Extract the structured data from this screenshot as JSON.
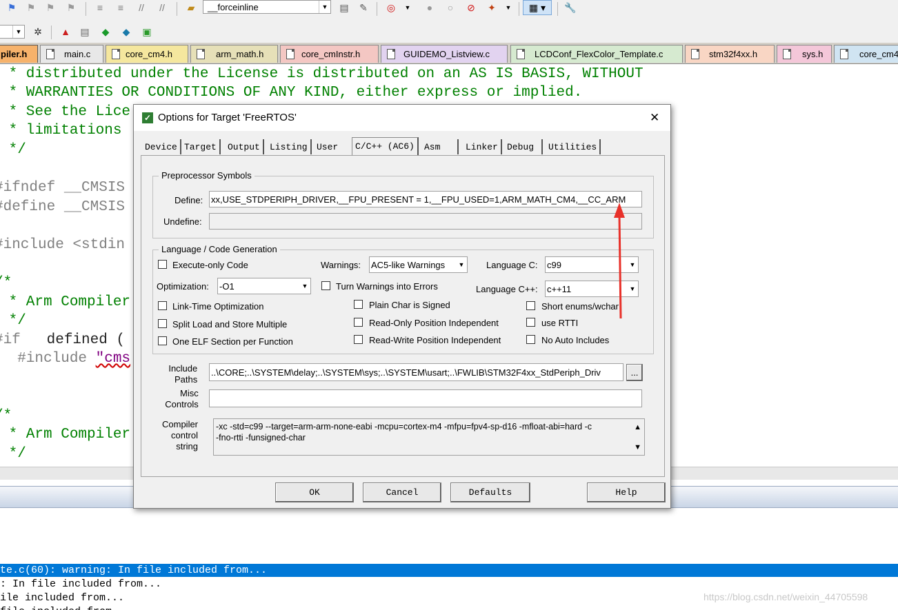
{
  "toolbar": {
    "target_combo": "__forceinline"
  },
  "file_tabs": [
    {
      "label": "piler.h",
      "color": "#f6b26b"
    },
    {
      "label": "main.c",
      "color": "#e8e8e8"
    },
    {
      "label": "core_cm4.h",
      "color": "#f5e79e"
    },
    {
      "label": "arm_math.h",
      "color": "#e6e0b8"
    },
    {
      "label": "core_cmInstr.h",
      "color": "#f4c7c3"
    },
    {
      "label": "GUIDEMO_Listview.c",
      "color": "#e2d3f0"
    },
    {
      "label": "LCDConf_FlexColor_Template.c",
      "color": "#d6ead0"
    },
    {
      "label": "stm32f4xx.h",
      "color": "#f9d6c4"
    },
    {
      "label": "sys.h",
      "color": "#f4c7d9"
    },
    {
      "label": "core_cm4",
      "color": "#d0e4f2"
    }
  ],
  "code_lines": {
    "l1": " * distributed under the License is distributed on an AS IS BASIS, WITHOUT",
    "l2": " * WARRANTIES OR CONDITIONS OF ANY KIND, either express or implied.",
    "l3": " * See the Lice",
    "l4": " * limitations",
    "l5": " */",
    "l6": "#ifndef __CMSIS",
    "l7": "#define __CMSIS",
    "l8": "#include <stdin",
    "l9": "/*",
    "l10": " * Arm Compiler",
    "l11": " */",
    "l12a": "#if",
    "l12b": "   defined (",
    "l13a": "  #include ",
    "l13b": "\"cms",
    "l14": "/*",
    "l15": " * Arm Compiler",
    "l16": " */"
  },
  "output": {
    "selected": "te.c(60): warning: In file included from...",
    "line2": ": In file included from...",
    "line3": "ile included from...",
    "line4": "file included from..."
  },
  "watermark": "https://blog.csdn.net/weixin_44705598",
  "dialog": {
    "title": "Options for Target 'FreeRTOS'",
    "close": "✕",
    "tabs": [
      "Device",
      "Target",
      "Output",
      "Listing",
      "User",
      "C/C++ (AC6)",
      "Asm",
      "Linker",
      "Debug",
      "Utilities"
    ],
    "active_tab": "C/C++ (AC6)",
    "preprocessor": {
      "group": "Preprocessor Symbols",
      "define_label": "Define:",
      "define_value": "xx,USE_STDPERIPH_DRIVER,__FPU_PRESENT = 1,__FPU_USED=1,ARM_MATH_CM4,__CC_ARM",
      "undefine_label": "Undefine:",
      "undefine_value": ""
    },
    "language": {
      "group": "Language / Code Generation",
      "execute_only": "Execute-only Code",
      "warnings_label": "Warnings:",
      "warnings_value": "AC5-like Warnings",
      "language_c_label": "Language C:",
      "language_c_value": "c99",
      "optimization_label": "Optimization:",
      "optimization_value": "-O1",
      "turn_warnings": "Turn Warnings into Errors",
      "language_cpp_label": "Language C++:",
      "language_cpp_value": "c++11",
      "link_time": "Link-Time Optimization",
      "plain_char": "Plain Char is Signed",
      "short_enums": "Short enums/wchar",
      "split_load": "Split Load and Store Multiple",
      "read_only": "Read-Only Position Independent",
      "use_rtti": "use RTTI",
      "one_elf": "One ELF Section per Function",
      "read_write": "Read-Write Position Independent",
      "no_auto": "No Auto Includes"
    },
    "include_paths_label1": "Include",
    "include_paths_label2": "Paths",
    "include_paths_value": "..\\CORE;..\\SYSTEM\\delay;..\\SYSTEM\\sys;..\\SYSTEM\\usart;..\\FWLIB\\STM32F4xx_StdPeriph_Driv",
    "browse": "...",
    "misc_label1": "Misc",
    "misc_label2": "Controls",
    "misc_value": "",
    "compiler_label1": "Compiler",
    "compiler_label2": "control",
    "compiler_label3": "string",
    "compiler_line1": "-xc -std=c99 --target=arm-arm-none-eabi -mcpu=cortex-m4 -mfpu=fpv4-sp-d16 -mfloat-abi=hard -c",
    "compiler_line2": "-fno-rtti -funsigned-char",
    "buttons": {
      "ok": "OK",
      "cancel": "Cancel",
      "defaults": "Defaults",
      "help": "Help"
    }
  },
  "annotation_color": "#e8312a"
}
